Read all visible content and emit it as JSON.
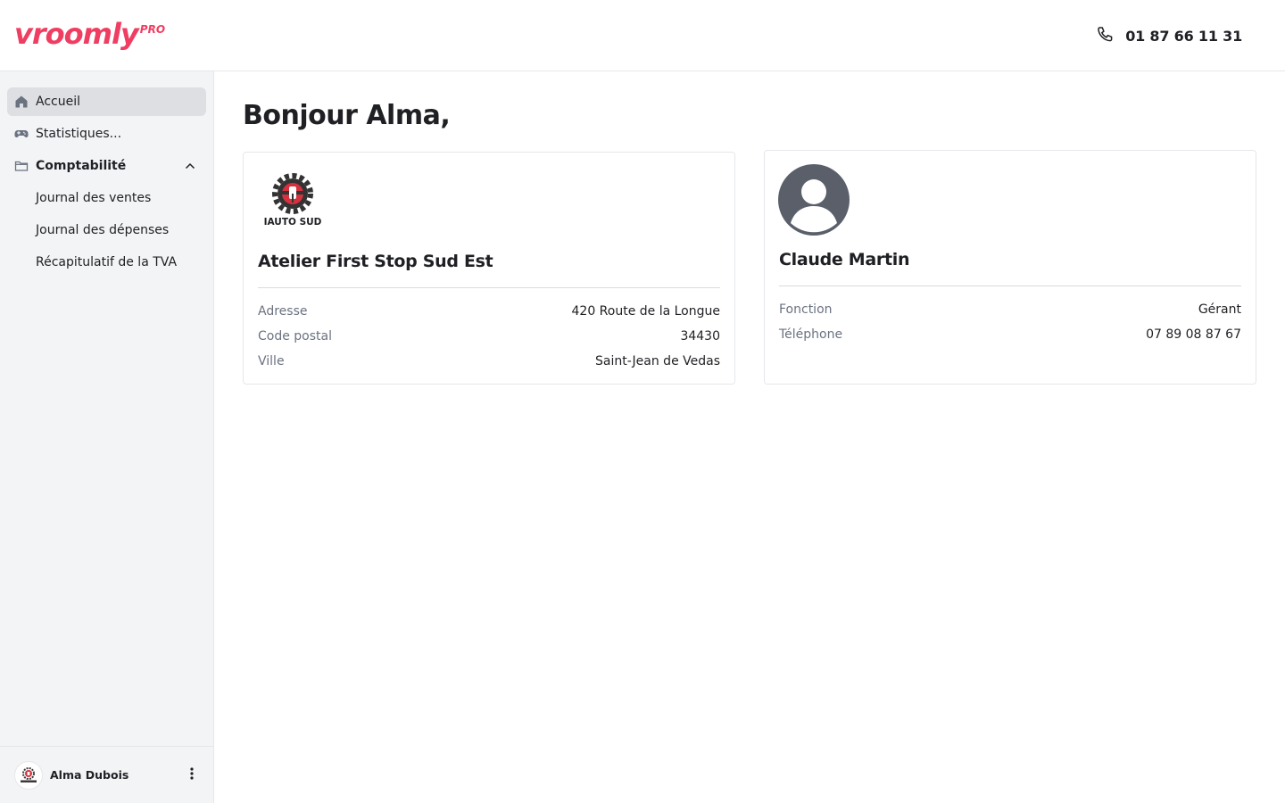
{
  "brand": {
    "name": "vroomly",
    "suffix": "PRO",
    "color": "#ef3e62"
  },
  "header": {
    "phone": "01 87 66 11 31",
    "phone_icon": "phone-icon"
  },
  "sidebar": {
    "items": [
      {
        "label": "Accueil",
        "icon": "home-icon",
        "active": true
      },
      {
        "label": "Statistiques...",
        "icon": "gamepad-icon"
      },
      {
        "label": "Comptabilité",
        "icon": "folder-icon",
        "expanded": true
      },
      {
        "label": "Journal des ventes"
      },
      {
        "label": "Journal des dépenses"
      },
      {
        "label": "Récapitulatif de la TVA"
      }
    ],
    "user": {
      "name": "Alma Dubois"
    }
  },
  "main": {
    "greeting": "Bonjour Alma,",
    "company": {
      "logo_text": "IAUTO SUD",
      "name": "Atelier First Stop Sud Est",
      "rows": [
        {
          "label": "Adresse",
          "value": "420 Route de la Longue"
        },
        {
          "label": "Code postal",
          "value": "34430"
        },
        {
          "label": "Ville",
          "value": "Saint-Jean de Vedas"
        }
      ]
    },
    "contact": {
      "name": "Claude Martin",
      "rows": [
        {
          "label": "Fonction",
          "value": "Gérant"
        },
        {
          "label": "Téléphone",
          "value": "07 89 08 87 67"
        }
      ]
    }
  }
}
